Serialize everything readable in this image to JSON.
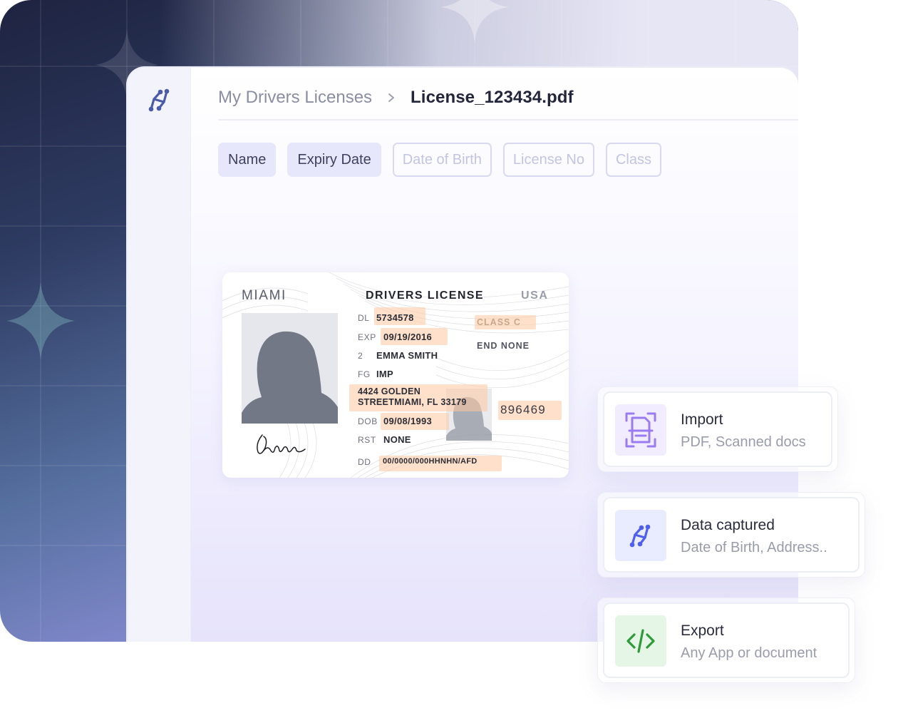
{
  "window": {
    "breadcrumb": {
      "parent": "My Drivers Licenses",
      "current": "License_123434.pdf"
    }
  },
  "fields": [
    {
      "label": "Name",
      "state": "selected"
    },
    {
      "label": "Expiry Date",
      "state": "selected"
    },
    {
      "label": "Date of Birth",
      "state": "unselected"
    },
    {
      "label": "License No",
      "state": "unselected"
    },
    {
      "label": "Class",
      "state": "unselected"
    }
  ],
  "license": {
    "city": "MIAMI",
    "title": "DRIVERS LICENSE",
    "country": "USA",
    "dl_label": "DL",
    "dl_value": "5734578",
    "exp_label": "EXP",
    "exp_value": "09/19/2016",
    "name_label": "2",
    "name_value": "EMMA SMITH",
    "fg_label": "FG",
    "fg_value": "IMP",
    "address_line1": "4424 GOLDEN",
    "address_line2": "STREETMIAMI, FL 33179",
    "dob_label": "DOB",
    "dob_value": "09/08/1993",
    "rst_label": "RST",
    "rst_value": "NONE",
    "dd_label": "DD",
    "dd_value": "00/0000/000HHNHN/AFD",
    "class_value": "CLASS C",
    "end_value": "END NONE",
    "number_value": "896469"
  },
  "features": [
    {
      "title": "Import",
      "subtitle": "PDF, Scanned docs",
      "icon": "document-scan-icon",
      "color": "#9b7cf0",
      "bg": "#f1ecff"
    },
    {
      "title": "Data captured",
      "subtitle": "Date of Birth, Address..",
      "icon": "nanonets-logo-icon",
      "color": "#4e5ff0",
      "bg": "#e9ecff"
    },
    {
      "title": "Export",
      "subtitle": "Any App or document",
      "icon": "code-icon",
      "color": "#2e9a3a",
      "bg": "#e6f6e6"
    }
  ],
  "colors": {
    "accent": "#4e5ff0",
    "highlight": "#ffd9bf",
    "chip_fill": "#e7e7fb"
  }
}
